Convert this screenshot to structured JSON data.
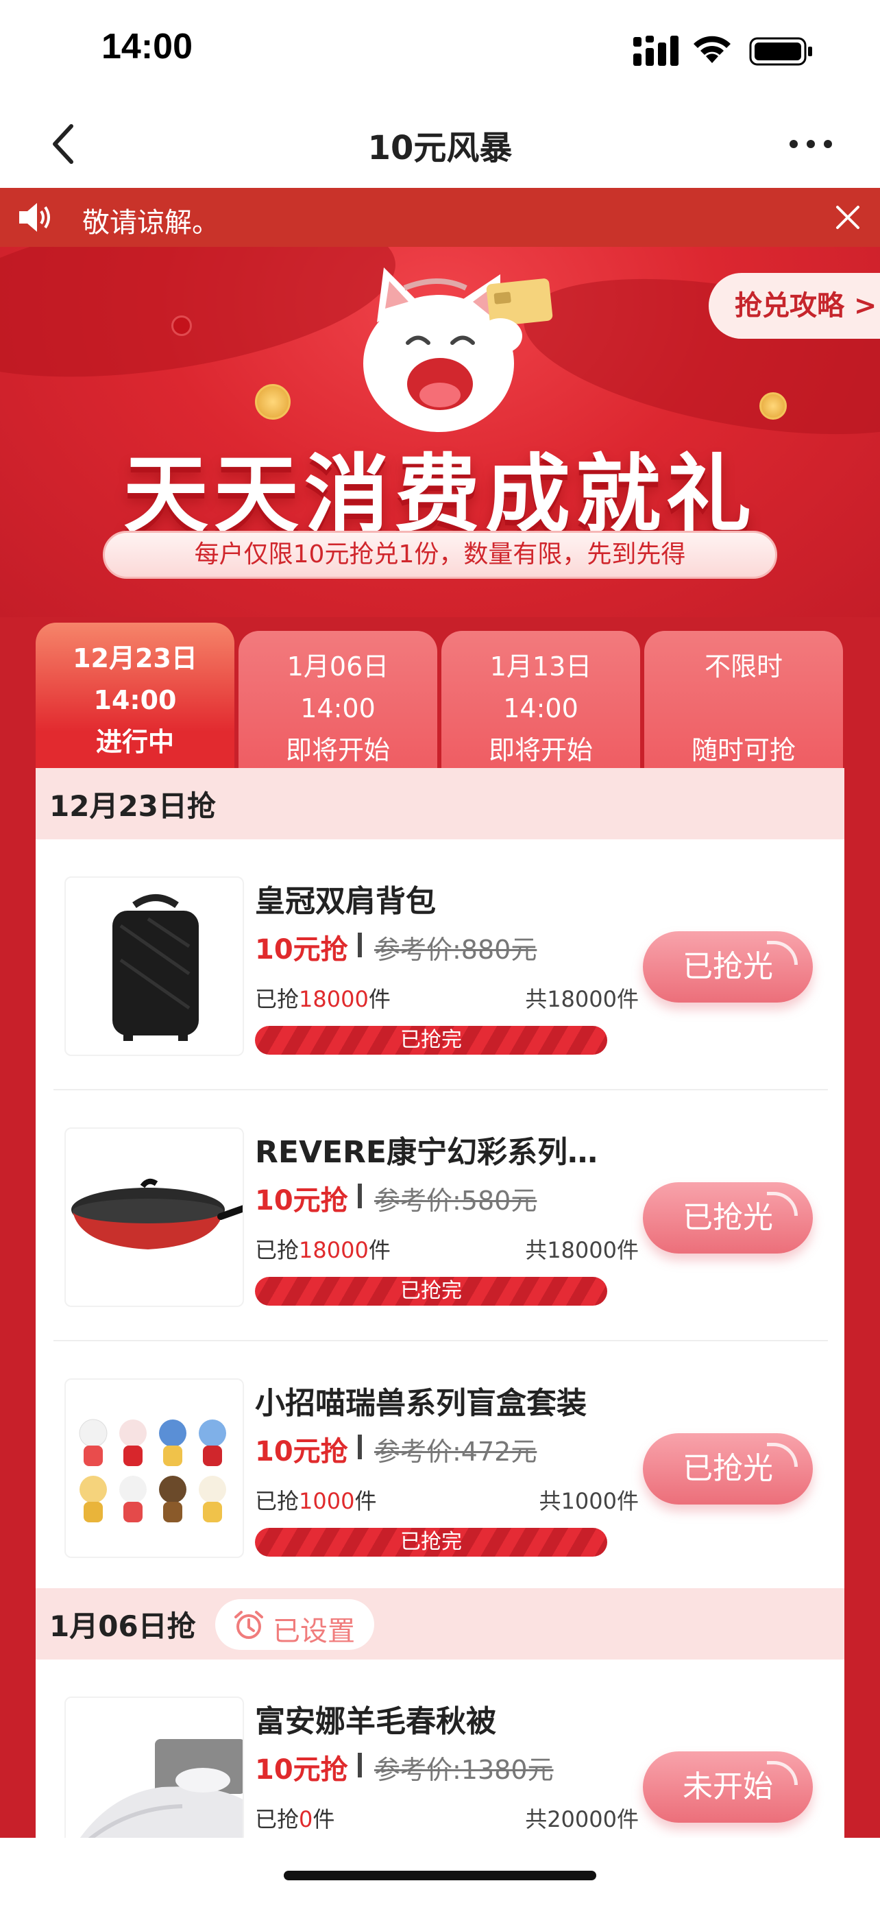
{
  "status_bar": {
    "time": "14:00"
  },
  "nav": {
    "title": "10元风暴"
  },
  "notice": {
    "text": "敬请谅解。"
  },
  "banner": {
    "title": "天天消费成就礼",
    "subtitle": "每户仅限10元抢兑1份，数量有限，先到先得",
    "guide_label": "抢兑攻略 >"
  },
  "tabs": [
    {
      "date": "12月23日",
      "time": "14:00",
      "status": "进行中",
      "active": true
    },
    {
      "date": "1月06日",
      "time": "14:00",
      "status": "即将开始",
      "active": false
    },
    {
      "date": "1月13日",
      "time": "14:00",
      "status": "即将开始",
      "active": false
    },
    {
      "date": "不限时",
      "time": "",
      "status": "随时可抢",
      "active": false
    }
  ],
  "sections": [
    {
      "title": "12月23日抢",
      "items": [
        {
          "name": "皇冠双肩背包",
          "price": "10元抢",
          "ref_price": "参考价:880元",
          "sold_prefix": "已抢",
          "sold_num": "18000",
          "sold_suffix": "件",
          "total": "共18000件",
          "progress": 1.0,
          "bar_label": "已抢完",
          "action": "已抢光",
          "image": "backpack"
        },
        {
          "name": "REVERE康宁幻彩系列…",
          "price": "10元抢",
          "ref_price": "参考价:580元",
          "sold_prefix": "已抢",
          "sold_num": "18000",
          "sold_suffix": "件",
          "total": "共18000件",
          "progress": 1.0,
          "bar_label": "已抢完",
          "action": "已抢光",
          "image": "wok-pan"
        },
        {
          "name": "小招喵瑞兽系列盲盒套装",
          "price": "10元抢",
          "ref_price": "参考价:472元",
          "sold_prefix": "已抢",
          "sold_num": "1000",
          "sold_suffix": "件",
          "total": "共1000件",
          "progress": 1.0,
          "bar_label": "已抢完",
          "action": "已抢光",
          "image": "blind-box-figures"
        }
      ]
    },
    {
      "title": "1月06日抢",
      "reminder": "已设置",
      "items": [
        {
          "name": "富安娜羊毛春秋被",
          "price": "10元抢",
          "ref_price": "参考价:1380元",
          "sold_prefix": "已抢",
          "sold_num": "0",
          "sold_suffix": "件",
          "total": "共20000件",
          "progress": 0.0,
          "action": "未开始",
          "image": "bedding"
        }
      ]
    }
  ],
  "colors": {
    "brand_red": "#c8202a",
    "price_red": "#e02a2c",
    "button_pink": "#ec6f7a"
  }
}
